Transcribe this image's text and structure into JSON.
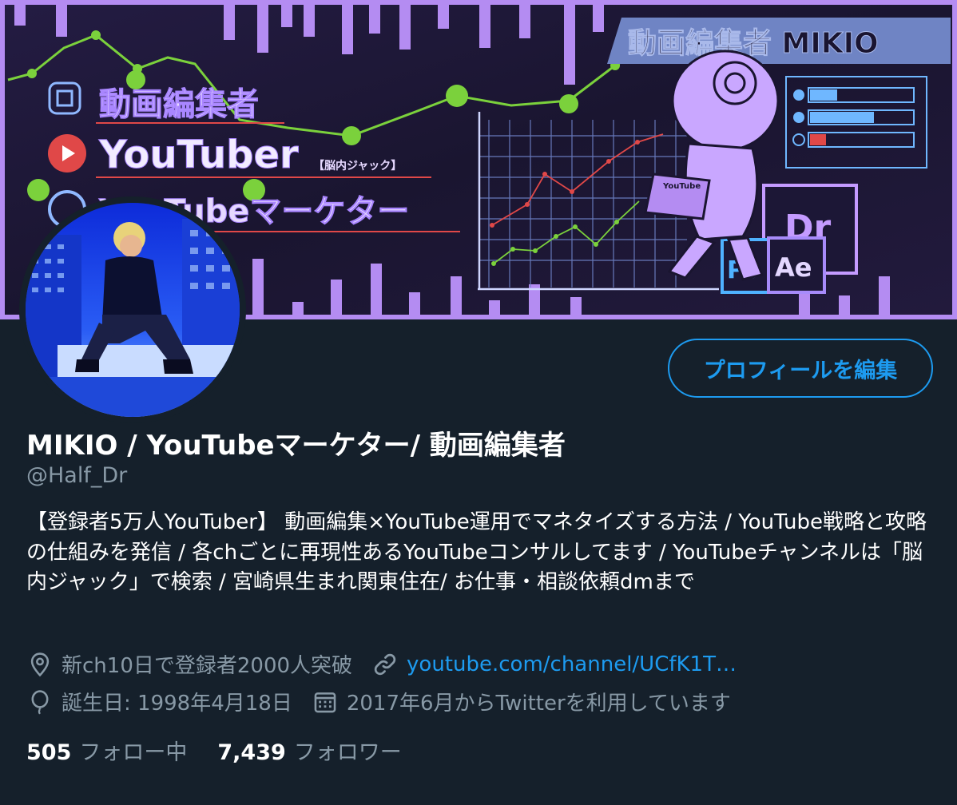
{
  "banner": {
    "title_tag": "動画編集者 MIKIO",
    "roles": [
      "動画編集者",
      "YouTuber",
      "YouTubeマーケター"
    ],
    "role_note": "【脳内ジャック】",
    "laptop_label": "YouTube",
    "app_badges": [
      "Dr",
      "Ps",
      "Ae"
    ],
    "colors": {
      "purple": "#b48cf2",
      "neon_green": "#7bd13c",
      "bg": "#1b1633",
      "accent_red": "#e04848"
    }
  },
  "profile": {
    "edit_button_label": "プロフィールを編集",
    "display_name": "MIKIO / YouTubeマーケター/ 動画編集者",
    "handle": "@Half_Dr",
    "bio": "【登録者5万人YouTuber】 動画編集×YouTube運用でマネタイズする方法 / YouTube戦略と攻略の仕組みを発信 / 各chごとに再現性あるYouTubeコンサルしてます / YouTubeチャンネルは「脳内ジャック」で検索 / 宮崎県生まれ関東住在/ お仕事・相談依頼dmまで",
    "location": "新ch10日で登録者2000人突破",
    "url": "youtube.com/channel/UCfK1T…",
    "birthday": "誕生日: 1998年4月18日",
    "joined": "2017年6月からTwitterを利用しています",
    "following_count": "505",
    "following_label": "フォロー中",
    "followers_count": "7,439",
    "followers_label": "フォロワー"
  },
  "icons": {
    "location": "location-pin-icon",
    "link": "link-icon",
    "birthday": "balloon-icon",
    "joined": "calendar-icon"
  }
}
